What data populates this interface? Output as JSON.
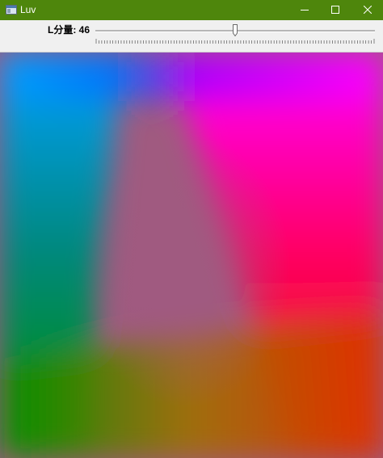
{
  "window": {
    "title": "Luv",
    "titlebar_color": "#4e860c",
    "icons": {
      "app": "app-window-icon",
      "minimize": "minimize-icon",
      "maximize": "maximize-icon",
      "close": "close-icon"
    }
  },
  "toolbar": {
    "slider_label": "L分量: 46",
    "slider": {
      "min": 0,
      "max": 100,
      "value": 46
    }
  },
  "canvas": {
    "colors": {
      "top_left": "#00a0ff",
      "top_mid": "#0066ff",
      "top_purple": "#9a00ff",
      "top_right": "#ff00ff",
      "middle_right": "#ff0060",
      "right": "#ff0000",
      "bottom_right": "#e03000",
      "bottom_mid": "#a07000",
      "bottom_left": "#009000",
      "left_mid": "#00887a",
      "center": "#a05a80"
    }
  }
}
